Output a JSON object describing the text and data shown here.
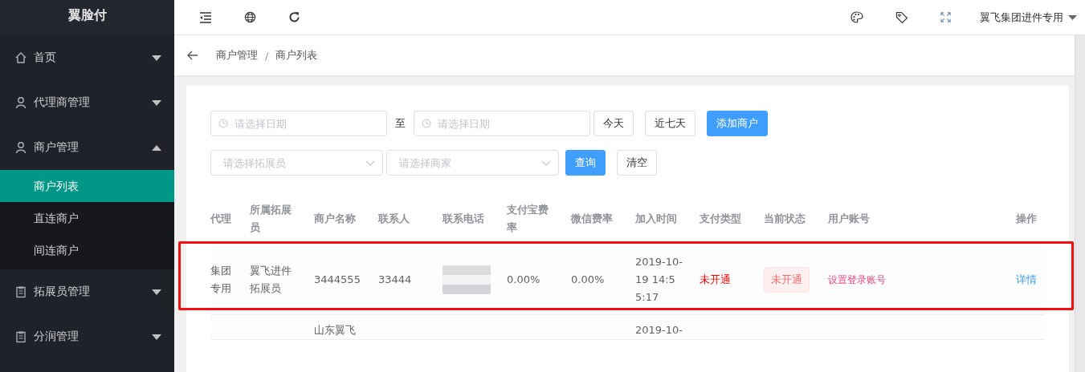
{
  "logo": "翼脸付",
  "sidebar": {
    "items": [
      {
        "label": "首页",
        "kind": "home",
        "expanded": false
      },
      {
        "label": "代理商管理",
        "kind": "person",
        "expanded": false
      },
      {
        "label": "商户管理",
        "kind": "person",
        "expanded": true,
        "children": [
          {
            "label": "商户列表",
            "selected": true
          },
          {
            "label": "直连商户",
            "selected": false
          },
          {
            "label": "间连商户",
            "selected": false
          }
        ]
      },
      {
        "label": "拓展员管理",
        "kind": "clipboard",
        "expanded": false
      },
      {
        "label": "分润管理",
        "kind": "clipboard",
        "expanded": false
      }
    ]
  },
  "topbar": {
    "user": "翼飞集团进件专用"
  },
  "breadcrumb": {
    "items": [
      "商户管理",
      "商户列表"
    ],
    "separator": "/"
  },
  "filters": {
    "date_start": {
      "placeholder": "请选择日期"
    },
    "separator": "至",
    "date_end": {
      "placeholder": "请选择日期"
    },
    "date_buttons": [
      {
        "label": "今天",
        "kind": "plain"
      },
      {
        "label": "近七天",
        "kind": "plain"
      },
      {
        "label": "添加商户",
        "kind": "primary"
      }
    ],
    "selects": [
      {
        "placeholder": "请选择拓展员"
      },
      {
        "placeholder": "请选择商家"
      }
    ],
    "query_buttons": [
      {
        "label": "查询",
        "kind": "primary"
      },
      {
        "label": "清空",
        "kind": "plain"
      }
    ]
  },
  "table": {
    "columns": [
      "代理",
      "所属拓展员",
      "商户名称",
      "联系人",
      "联系电话",
      "支付宝费率",
      "微信费率",
      "加入时间",
      "支付类型",
      "当前状态",
      "用户账号",
      "操作"
    ],
    "rows": [
      {
        "highlighted": true,
        "cells": [
          {
            "kind": "text",
            "text": "集团专用"
          },
          {
            "kind": "text",
            "text": "翼飞进件拓展员"
          },
          {
            "kind": "text",
            "text": "3444555"
          },
          {
            "kind": "text",
            "text": "33444"
          },
          {
            "kind": "redacted"
          },
          {
            "kind": "text",
            "text": "0.00%"
          },
          {
            "kind": "text",
            "text": "0.00%"
          },
          {
            "kind": "text",
            "text": "2019-10-19 14:55:17"
          },
          {
            "kind": "danger",
            "text": "未开通"
          },
          {
            "kind": "tag",
            "text": "未开通"
          },
          {
            "kind": "danger-link",
            "text": "设置登录账号"
          },
          {
            "kind": "link",
            "text": "详情"
          }
        ]
      },
      {
        "highlighted": false,
        "cells": [
          {
            "kind": "empty"
          },
          {
            "kind": "empty"
          },
          {
            "kind": "text",
            "text": "山东翼飞"
          },
          {
            "kind": "empty"
          },
          {
            "kind": "empty"
          },
          {
            "kind": "empty"
          },
          {
            "kind": "empty"
          },
          {
            "kind": "text",
            "text": "2019-10-"
          },
          {
            "kind": "empty"
          },
          {
            "kind": "empty"
          },
          {
            "kind": "empty"
          },
          {
            "kind": "empty"
          }
        ]
      }
    ]
  }
}
